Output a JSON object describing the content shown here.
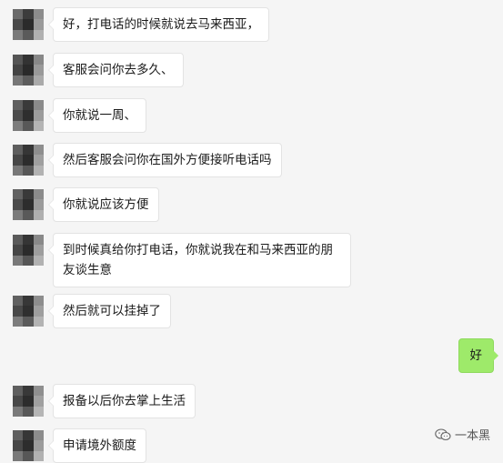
{
  "conversation": {
    "received": [
      {
        "text": "好，打电话的时候就说去马来西亚，"
      },
      {
        "text": "客服会问你去多久、"
      },
      {
        "text": "你就说一周、"
      },
      {
        "text": "然后客服会问你在国外方便接听电话吗"
      },
      {
        "text": "你就说应该方便"
      },
      {
        "text": "到时候真给你打电话，你就说我在和马来西亚的朋友谈生意"
      },
      {
        "text": "然后就可以挂掉了"
      },
      {
        "text": "报备以后你去掌上生活"
      },
      {
        "text": "申请境外额度"
      }
    ],
    "sent": [
      {
        "text": "好"
      }
    ]
  },
  "watermark": {
    "text": "一本黑",
    "icon": "wechat-icon"
  },
  "colors": {
    "background": "#f5f5f5",
    "received_bubble": "#ffffff",
    "sent_bubble": "#9eea6a"
  }
}
